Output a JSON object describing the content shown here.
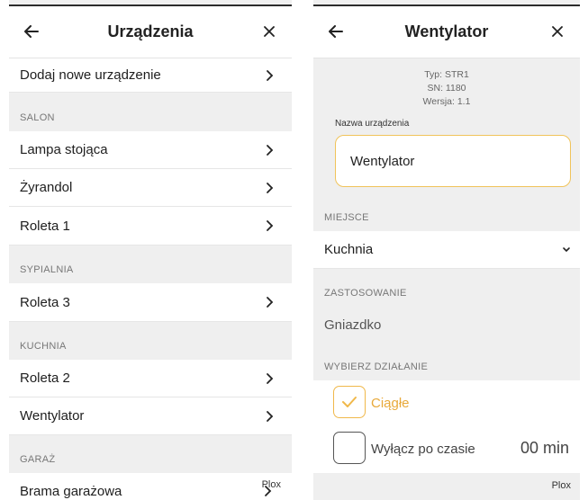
{
  "devices_screen": {
    "title": "Urządzenia",
    "add_label": "Dodaj nowe urządzenie",
    "sections": [
      {
        "label": "SALON",
        "items": [
          "Lampa stojąca",
          "Żyrandol",
          "Roleta 1"
        ]
      },
      {
        "label": "SYPIALNIA",
        "items": [
          "Roleta 3"
        ]
      },
      {
        "label": "KUCHNIA",
        "items": [
          "Roleta 2",
          "Wentylator"
        ]
      },
      {
        "label": "GARAŻ",
        "items": [
          "Brama garażowa"
        ]
      }
    ],
    "watermark": "Plox"
  },
  "device_screen": {
    "title": "Wentylator",
    "type": "Typ: STR1",
    "sn": "SN: 1180",
    "version": "Wersja: 1.1",
    "name_label": "Nazwa urządzenia",
    "name_value": "Wentylator",
    "location_header": "MIEJSCE",
    "location_value": "Kuchnia",
    "usage_header": "ZASTOSOWANIE",
    "usage_value": "Gniazdko",
    "action_header": "WYBIERZ DZIAŁANIE",
    "option_continuous": "Ciągłe",
    "option_continuous_checked": true,
    "option_timer": "Wyłącz po czasie",
    "option_timer_checked": false,
    "timer_value": "00 min",
    "watermark": "Plox"
  },
  "colors": {
    "accent": "#f0b84a",
    "accent_text": "#e8a93a",
    "section_bg": "#efefef",
    "muted_text": "#777777"
  },
  "icons": [
    "back-arrow-icon",
    "close-icon",
    "chevron-right-icon",
    "chevron-down-icon",
    "checkmark-icon"
  ]
}
